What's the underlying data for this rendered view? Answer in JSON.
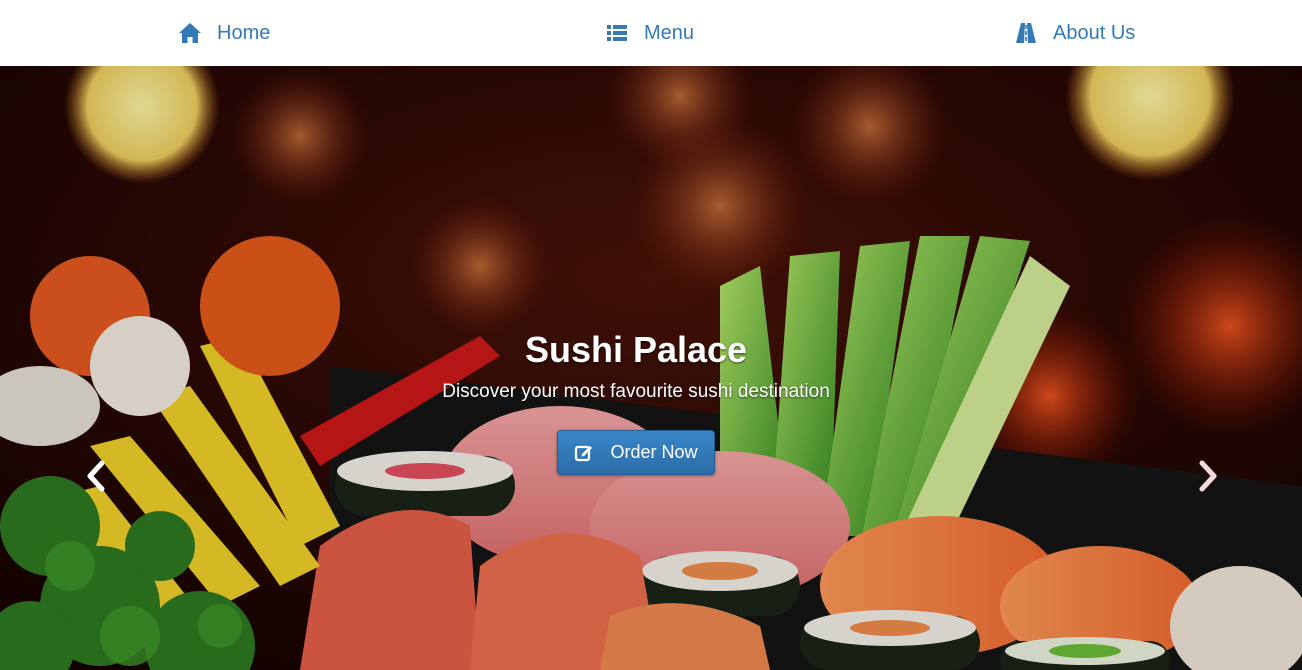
{
  "nav": {
    "items": [
      {
        "label": "Home",
        "icon": "home-icon"
      },
      {
        "label": "Menu",
        "icon": "list-icon"
      },
      {
        "label": "About Us",
        "icon": "road-icon"
      }
    ]
  },
  "hero": {
    "title": "Sushi Palace",
    "subtitle": "Discover your most favourite sushi destination",
    "cta_label": "Order Now",
    "cta_icon": "edit-icon"
  },
  "colors": {
    "link": "#337ab7",
    "button": "#337ab7",
    "caption_text": "#ffffff"
  }
}
